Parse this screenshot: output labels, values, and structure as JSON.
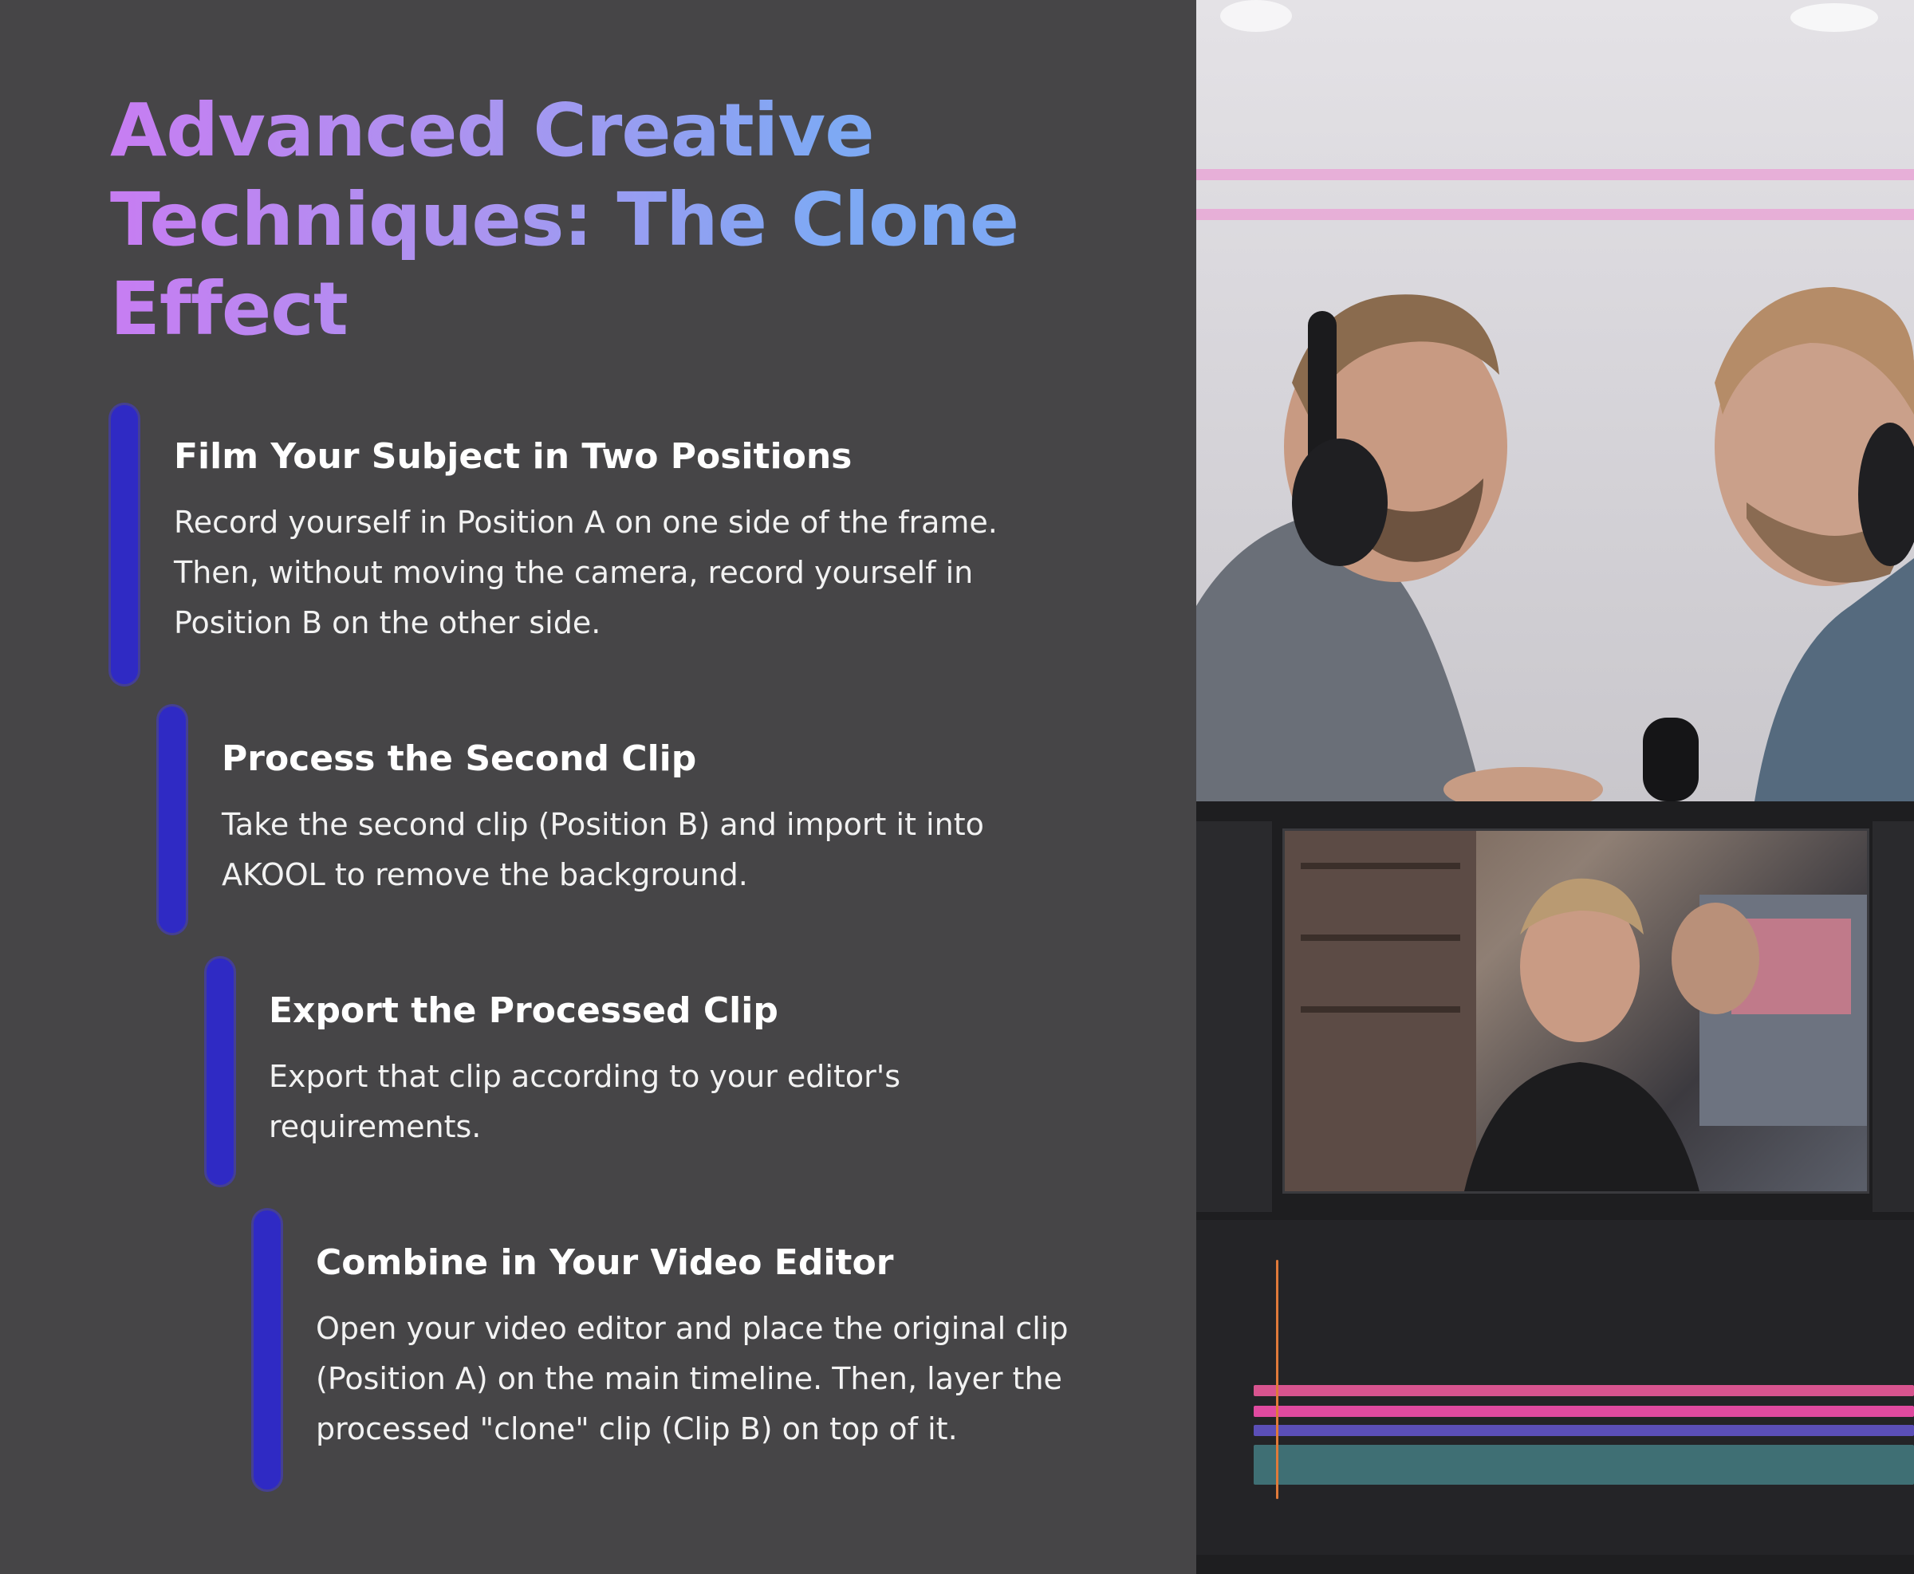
{
  "heading": {
    "line1": "Advanced Creative",
    "line2": "Techniques: The Clone",
    "line3": "Effect"
  },
  "steps": [
    {
      "title": "Film Your Subject in Two Positions",
      "lines": [
        "Record yourself in Position A on one side of the frame.",
        "Then, without moving the camera, record yourself in",
        "Position B on the other side."
      ]
    },
    {
      "title": "Process the Second Clip",
      "lines": [
        "Take the second clip (Position B) and import it into",
        "AKOOL to remove the background."
      ]
    },
    {
      "title": "Export the Processed Clip",
      "lines": [
        "Export that clip according to your editor's",
        "requirements."
      ]
    },
    {
      "title": "Combine in Your Video Editor",
      "lines": [
        "Open your video editor and place the original clip",
        "(Position A) on the main timeline. Then, layer the",
        "processed \"clone\" clip (Clip B) on top of it."
      ]
    }
  ],
  "colors": {
    "background": "#464547",
    "accent_bar": "#2f2ac4",
    "title_gradient_start": "#c77df2",
    "title_gradient_end": "#7ea9f4"
  },
  "image": {
    "description_icon": "photo-clone-effect-video-editor"
  }
}
